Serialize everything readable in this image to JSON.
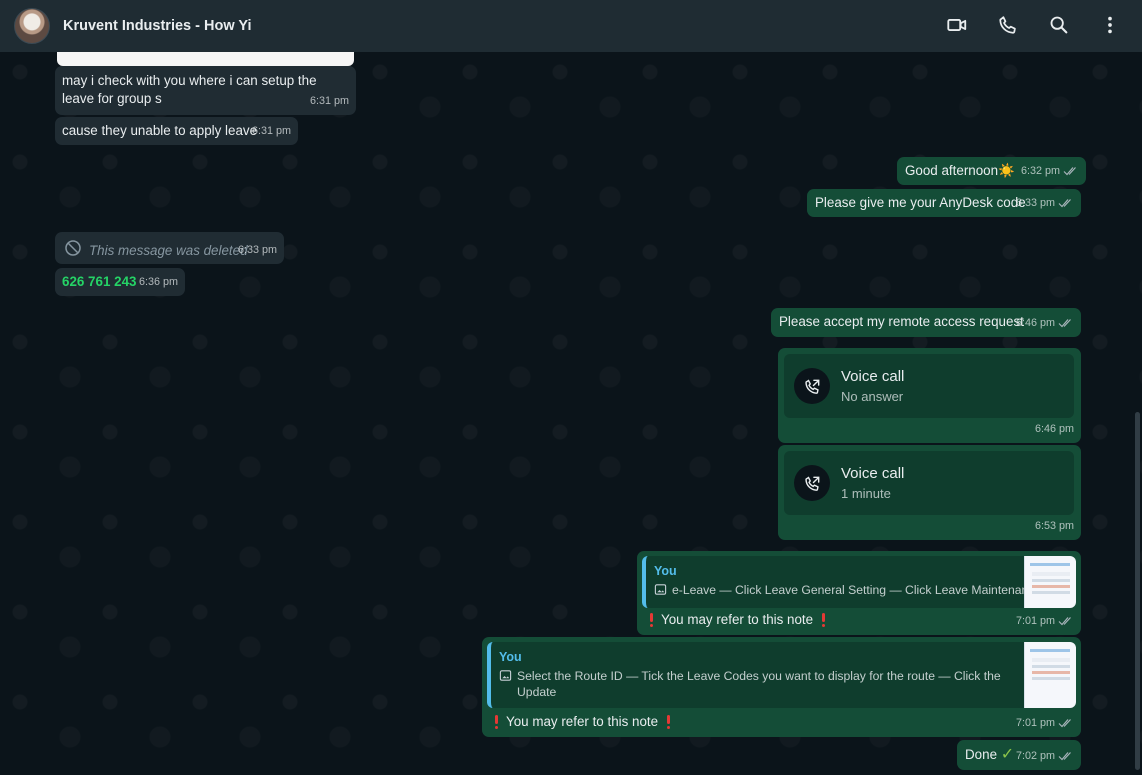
{
  "chat": {
    "title": "Kruvent Industries - How Yi",
    "messages": [
      {
        "text": "may i check with you where i can setup the leave for group s",
        "time": "6:31 pm"
      },
      {
        "text": "cause they unable to apply leave",
        "time": "6:31 pm"
      },
      {
        "text": "Good afternoon",
        "emoji": "☀️",
        "time": "6:32 pm"
      },
      {
        "text": "Please give me your AnyDesk code",
        "time": "6:33 pm"
      },
      {
        "text": "This message was deleted",
        "time": "6:33 pm"
      },
      {
        "text": "626 761 243",
        "time": "6:36 pm"
      },
      {
        "text": "Please accept my remote access request",
        "time": "6:46 pm"
      },
      {
        "title": "Voice call",
        "status": "No answer",
        "time": "6:46 pm"
      },
      {
        "title": "Voice call",
        "status": "1 minute",
        "time": "6:53 pm"
      },
      {
        "quote_author": "You",
        "quote_text": "e-Leave — Click Leave General Setting — Click Leave Maintenance",
        "text": "You may refer to this note",
        "time": "7:01 pm"
      },
      {
        "quote_author": "You",
        "quote_text": "Select the Route ID — Tick the Leave Codes you want to display for the route — Click the Update",
        "quote_more": "...",
        "text": "You may refer to this note",
        "time": "7:01 pm"
      },
      {
        "text": "Done",
        "time": "7:02 pm"
      }
    ]
  },
  "icons": {
    "video": "video-call-icon",
    "call": "phone-icon",
    "search": "search-icon",
    "menu": "more-options-icon",
    "deleted": "blocked-icon",
    "read": "double-check-icon",
    "voice_call": "call-icon",
    "quote_image": "image-icon",
    "alert": "exclamation-icon",
    "done": "check-icon"
  },
  "colors": {
    "header": "#1f2c33",
    "incoming": "#202c33",
    "outgoing": "#144d37",
    "accent": "#25d366",
    "quote": "#53bdeb"
  }
}
